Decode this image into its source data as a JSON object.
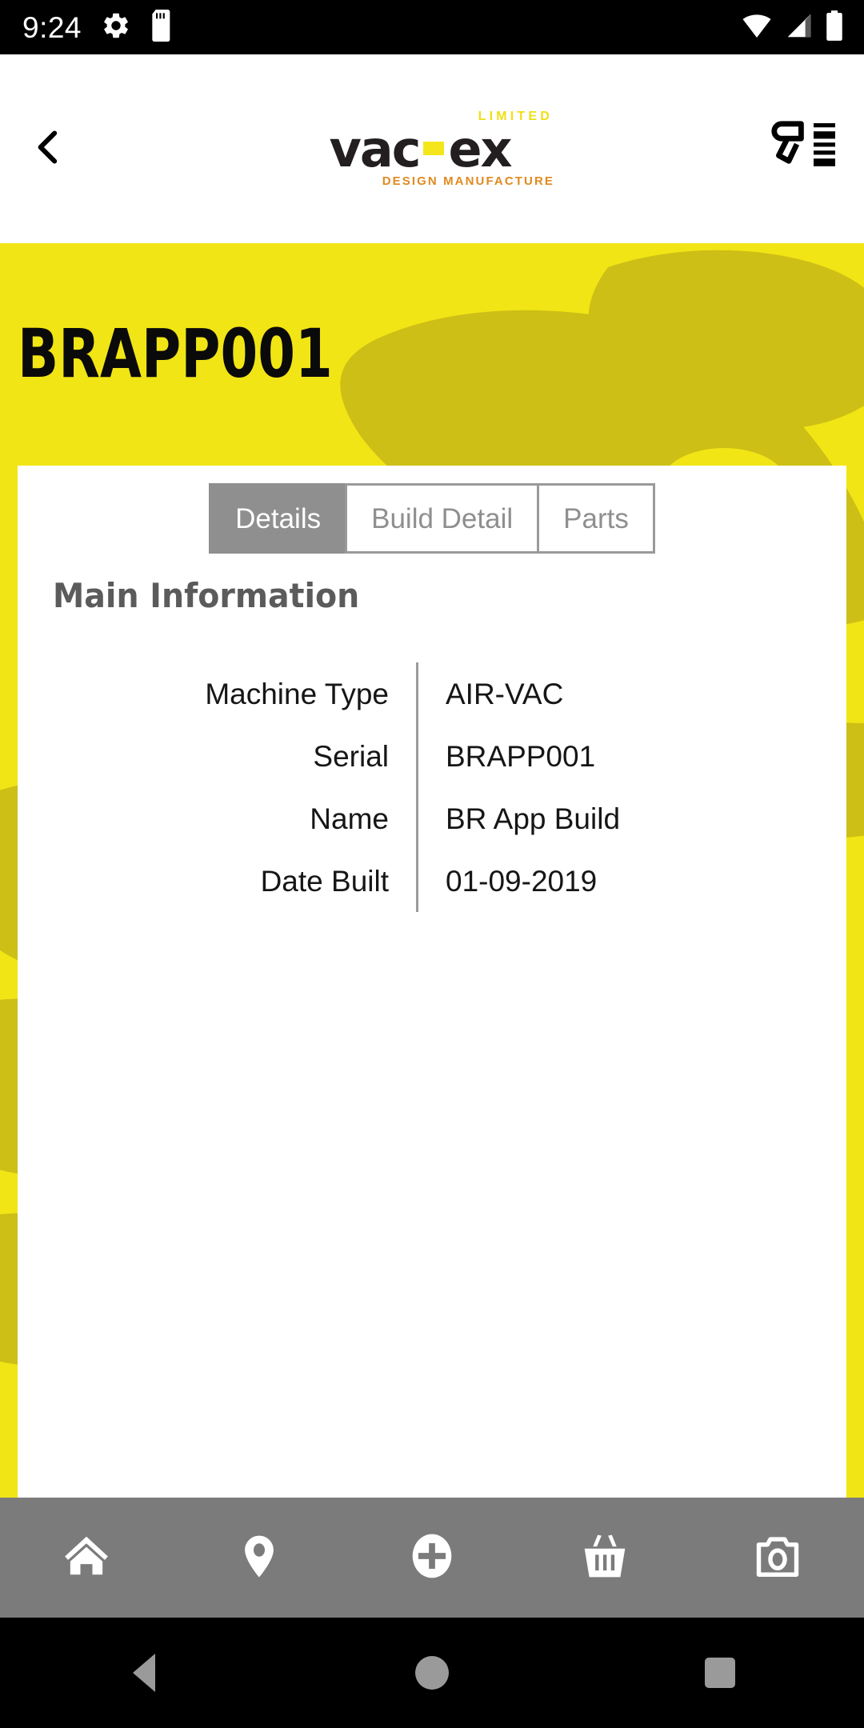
{
  "status_bar": {
    "time": "9:24",
    "left_icons": [
      "gear-icon",
      "sd-card-icon"
    ],
    "right_icons": [
      "wifi-icon",
      "cellular-signal-icon",
      "battery-icon"
    ]
  },
  "app_bar": {
    "back_icon": "chevron-left-icon",
    "logo": {
      "brand": "vac",
      "brand_suffix": "ex",
      "limited": "LIMITED",
      "tagline": "DESIGN MANUFACTURE"
    },
    "scan_icon": "barcode-scanner-icon"
  },
  "hero": {
    "title": "BRAPP001",
    "background_color": "#F2E515",
    "blob_color": "#CDBF16"
  },
  "tabs": [
    {
      "label": "Details",
      "active": true
    },
    {
      "label": "Build Detail",
      "active": false
    },
    {
      "label": "Parts",
      "active": false
    }
  ],
  "main_information": {
    "heading": "Main Information",
    "rows": [
      {
        "label": "Machine Type",
        "value": "AIR-VAC"
      },
      {
        "label": "Serial",
        "value": "BRAPP001"
      },
      {
        "label": "Name",
        "value": "BR App Build"
      },
      {
        "label": "Date Built",
        "value": "01-09-2019"
      }
    ]
  },
  "bottom_nav": [
    {
      "icon": "home-icon",
      "label": "Home"
    },
    {
      "icon": "location-pin-icon",
      "label": "Location"
    },
    {
      "icon": "plus-circle-icon",
      "label": "Add"
    },
    {
      "icon": "basket-icon",
      "label": "Basket"
    },
    {
      "icon": "camera-icon",
      "label": "Camera"
    }
  ],
  "system_nav": [
    {
      "icon": "back-triangle-icon"
    },
    {
      "icon": "home-circle-icon"
    },
    {
      "icon": "recents-square-icon"
    }
  ],
  "colors": {
    "brand_yellow": "#F2E515",
    "nav_gray": "#7b7b7b",
    "tab_active_gray": "#8f8f8f",
    "logo_dark": "#231f20",
    "logo_orange": "#E08A20"
  }
}
